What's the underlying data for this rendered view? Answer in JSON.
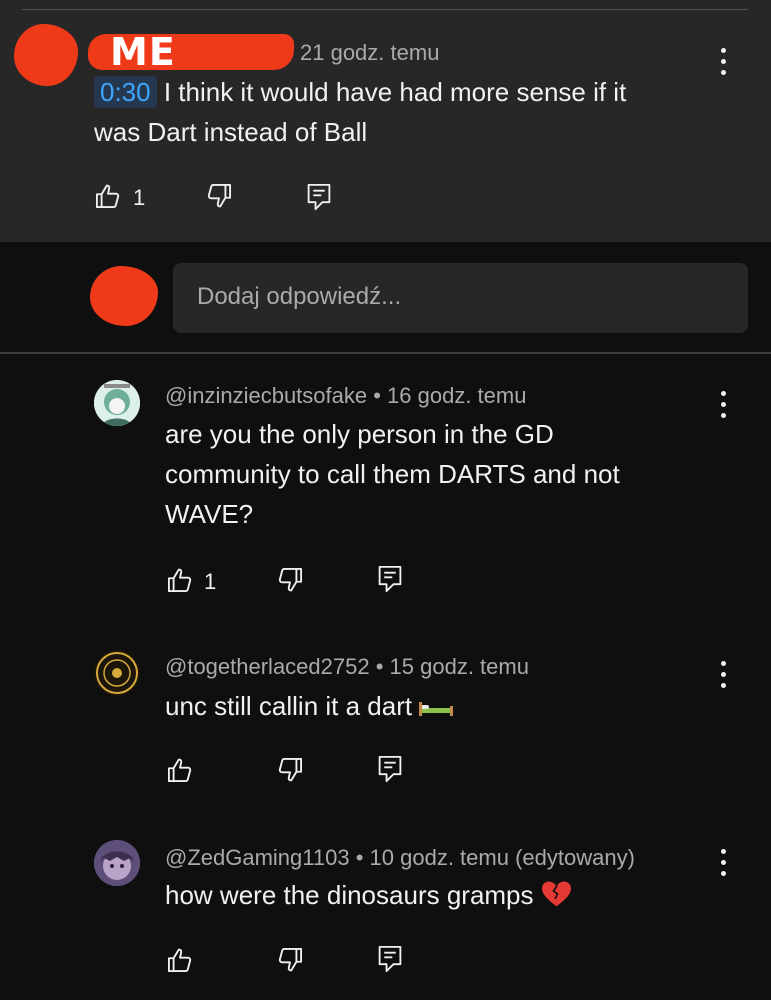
{
  "main_comment": {
    "author_label": "ME",
    "time": "21 godz. temu",
    "timestamp": "0:30",
    "text_line1": "I think it would have had more sense if it",
    "text_line2": "was Dart instead of Ball",
    "like_count": "1"
  },
  "reply_input": {
    "placeholder": "Dodaj odpowiedź..."
  },
  "replies": [
    {
      "handle": "@inzinziecbutsofake",
      "time": "16 godz. temu",
      "lines": [
        "are you the only person in the GD",
        "community to call them DARTS and not",
        "WAVE?"
      ],
      "like_count": "1"
    },
    {
      "handle": "@togetherlaced2752",
      "time": "15 godz. temu",
      "lines": [
        "unc still callin it a dart"
      ],
      "emoji": "bed",
      "like_count": ""
    },
    {
      "handle": "@ZedGaming1103",
      "time": "10 godz. temu (edytowany)",
      "lines": [
        "how were the dinosaurs gramps"
      ],
      "emoji": "broken-heart",
      "like_count": ""
    }
  ],
  "colors": {
    "background": "#0f0f0f",
    "comment_highlight": "#272727",
    "timestamp_link": "#3ea6ff",
    "redaction": "#ef3a1a"
  }
}
